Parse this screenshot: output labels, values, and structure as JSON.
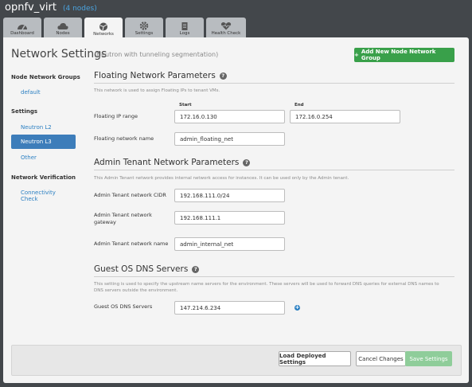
{
  "header": {
    "env_name": "opnfv_virt",
    "node_count": "(4 nodes)"
  },
  "tabs": [
    {
      "label": "Dashboard",
      "icon": "dashboard-icon"
    },
    {
      "label": "Nodes",
      "icon": "cloud-icon"
    },
    {
      "label": "Networks",
      "icon": "network-icon"
    },
    {
      "label": "Settings",
      "icon": "gear-icon"
    },
    {
      "label": "Logs",
      "icon": "clipboard-icon"
    },
    {
      "label": "Health Check",
      "icon": "heart-icon"
    }
  ],
  "active_tab": "Networks",
  "page": {
    "title": "Network Settings",
    "subtitle": "(Neutron with tunneling segmentation)",
    "add_button": "Add New Node Network Group"
  },
  "sidebar": {
    "groups_heading": "Node Network Groups",
    "group_default": "default",
    "settings_heading": "Settings",
    "item_l2": "Neutron L2",
    "item_l3": "Neutron L3",
    "item_other": "Other",
    "verification_heading": "Network Verification",
    "connectivity_line1": "Connectivity",
    "connectivity_line2": "Check"
  },
  "floating": {
    "title": "Floating Network Parameters",
    "desc": "This network is used to assign Floating IPs to tenant VMs.",
    "start_label": "Start",
    "end_label": "End",
    "range_label": "Floating IP range",
    "start_value": "172.16.0.130",
    "end_value": "172.16.0.254",
    "name_label": "Floating network name",
    "name_value": "admin_floating_net"
  },
  "admin_tenant": {
    "title": "Admin Tenant Network Parameters",
    "desc": "This Admin Tenant network provides internal network access for instances. It can be used only by the Admin tenant.",
    "cidr_label": "Admin Tenant network CIDR",
    "cidr_value": "192.168.111.0/24",
    "gateway_label_1": "Admin Tenant network",
    "gateway_label_2": "gateway",
    "gateway_value": "192.168.111.1",
    "name_label": "Admin Tenant network name",
    "name_value": "admin_internal_net"
  },
  "dns": {
    "title": "Guest OS DNS Servers",
    "desc_1": "This setting is used to specify the upstream name servers for the environment. These servers will be used to forward DNS queries for external DNS names to",
    "desc_2": "DNS servers outside the environment.",
    "label": "Guest OS DNS Servers",
    "value": "147.214.6.234"
  },
  "footer": {
    "load_button": "Load Deployed Settings",
    "cancel_button": "Cancel Changes",
    "save_button": "Save Settings"
  },
  "colors": {
    "accent_green": "#39a04a",
    "link_blue": "#2a7fc2",
    "active_blue": "#3d7dba",
    "background": "#43474b"
  }
}
